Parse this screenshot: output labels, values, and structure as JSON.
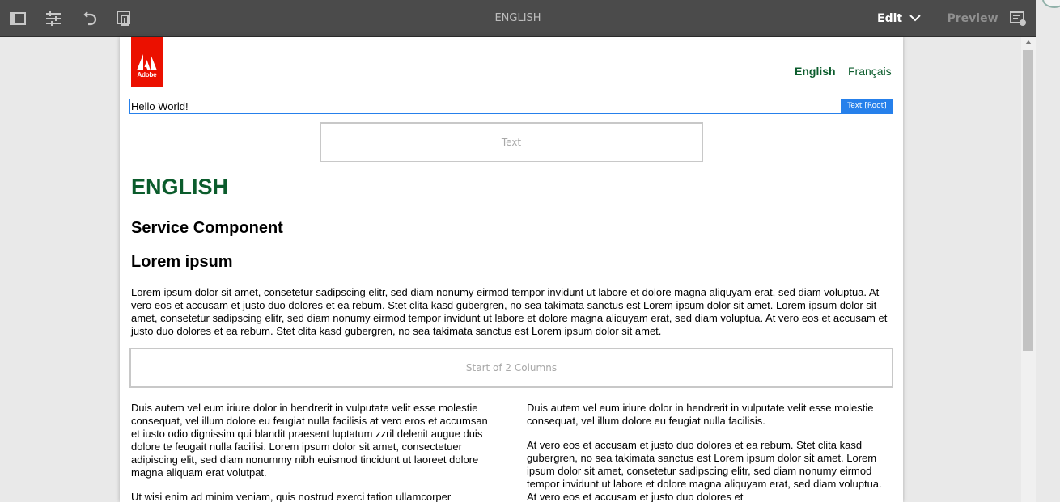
{
  "toolbar": {
    "title": "ENGLISH",
    "edit_label": "Edit",
    "preview_label": "Preview",
    "icons": [
      "side-panel-icon",
      "properties-icon",
      "undo-icon",
      "page-info-icon",
      "annotate-icon"
    ]
  },
  "header": {
    "logo_text": "Adobe",
    "languages": [
      "English",
      "Français"
    ]
  },
  "editor": {
    "hello_text": "Hello World!",
    "selected_label": "Text [Root]",
    "text_placeholder": "Text",
    "columns_placeholder": "Start of 2 Columns"
  },
  "content": {
    "title": "ENGLISH",
    "subtitle": "Service Component",
    "heading": "Lorem ipsum",
    "paragraph": "Lorem ipsum dolor sit amet, consetetur sadipscing elitr, sed diam nonumy eirmod tempor invidunt ut labore et dolore magna aliquyam erat, sed diam voluptua. At vero eos et accusam et justo duo dolores et ea rebum. Stet clita kasd gubergren, no sea takimata sanctus est Lorem ipsum dolor sit amet. Lorem ipsum dolor sit amet, consetetur sadipscing elitr, sed diam nonumy eirmod tempor invidunt ut labore et dolore magna aliquyam erat, sed diam voluptua. At vero eos et accusam et justo duo dolores et ea rebum. Stet clita kasd gubergren, no sea takimata sanctus est Lorem ipsum dolor sit amet.",
    "left_column": [
      "Duis autem vel eum iriure dolor in hendrerit in vulputate velit esse molestie consequat, vel illum dolore eu feugiat nulla facilisis at vero eros et accumsan et iusto odio dignissim qui blandit praesent luptatum zzril delenit augue duis dolore te feugait nulla facilisi. Lorem ipsum dolor sit amet, consectetuer adipiscing elit, sed diam nonummy nibh euismod tincidunt ut laoreet dolore magna aliquam erat volutpat.",
      "Ut wisi enim ad minim veniam, quis nostrud exerci tation ullamcorper"
    ],
    "right_column": [
      "Duis autem vel eum iriure dolor in hendrerit in vulputate velit esse molestie consequat, vel illum dolore eu feugiat nulla facilisis.",
      "At vero eos et accusam et justo duo dolores et ea rebum. Stet clita kasd gubergren, no sea takimata sanctus est Lorem ipsum dolor sit amet. Lorem ipsum dolor sit amet, consetetur sadipscing elitr, sed diam nonumy eirmod tempor invidunt ut labore et dolore magna aliquyam erat, sed diam voluptua. At vero eos et accusam et justo duo dolores et"
    ]
  },
  "colors": {
    "toolbar_bg": "#4b4b4b",
    "accent_green": "#0b5c2c",
    "selection_blue": "#2680eb",
    "adobe_red": "#eb1000"
  }
}
